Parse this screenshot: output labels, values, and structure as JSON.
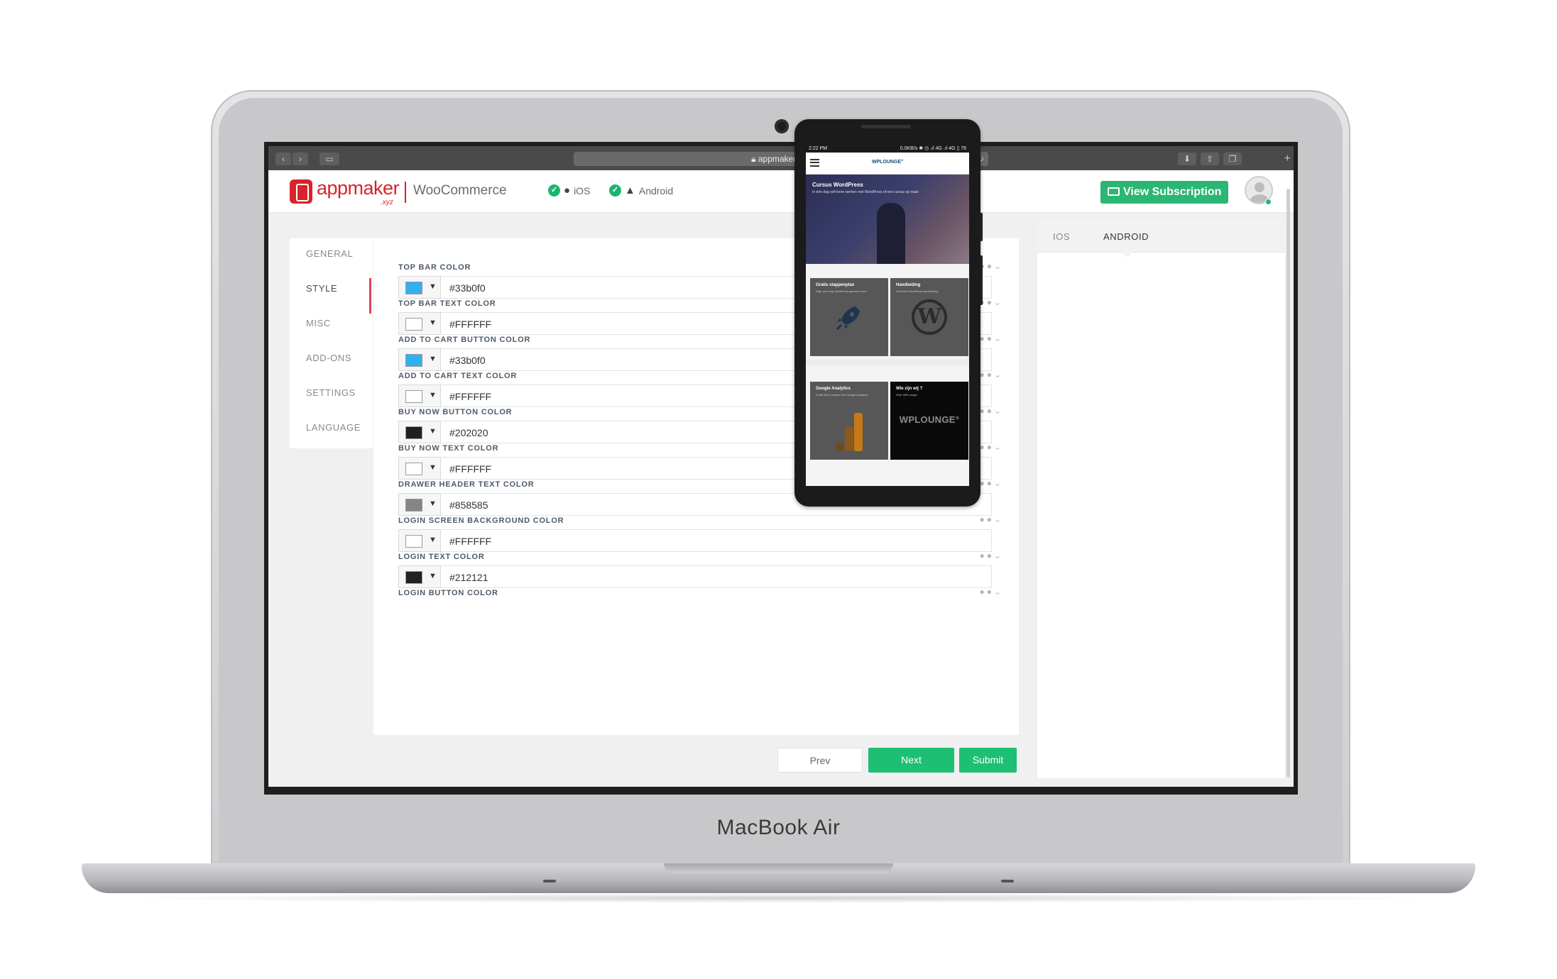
{
  "device": {
    "brand": "MacBook Air"
  },
  "browser": {
    "url": "appmaker.xyz"
  },
  "header": {
    "logo_text": "appmaker",
    "logo_sub": ".xyz",
    "platform": "WooCommerce",
    "ios_label": "iOS",
    "android_label": "Android",
    "subscription_button": "View Subscription"
  },
  "nav": {
    "items": [
      {
        "label": "GENERAL"
      },
      {
        "label": "STYLE"
      },
      {
        "label": "MISC"
      },
      {
        "label": "ADD-ONS"
      },
      {
        "label": "SETTINGS"
      },
      {
        "label": "LANGUAGE"
      }
    ],
    "active": "STYLE"
  },
  "fields": [
    {
      "label": "TOP BAR COLOR",
      "value": "#33b0f0",
      "swatch": "#33b0f0"
    },
    {
      "label": "TOP BAR TEXT COLOR",
      "value": "#FFFFFF",
      "swatch": "#FFFFFF"
    },
    {
      "label": "ADD TO CART BUTTON COLOR",
      "value": "#33b0f0",
      "swatch": "#33b0f0"
    },
    {
      "label": "ADD TO CART TEXT COLOR",
      "value": "#FFFFFF",
      "swatch": "#FFFFFF"
    },
    {
      "label": "BUY NOW BUTTON COLOR",
      "value": "#202020",
      "swatch": "#202020"
    },
    {
      "label": "BUY NOW TEXT COLOR",
      "value": "#FFFFFF",
      "swatch": "#FFFFFF"
    },
    {
      "label": "DRAWER HEADER TEXT COLOR",
      "value": "#858585",
      "swatch": "#858585"
    },
    {
      "label": "LOGIN SCREEN BACKGROUND COLOR",
      "value": "#FFFFFF",
      "swatch": "#FFFFFF"
    },
    {
      "label": "LOGIN TEXT COLOR",
      "value": "#212121",
      "swatch": "#212121"
    },
    {
      "label": "LOGIN BUTTON COLOR",
      "value": "",
      "swatch": ""
    }
  ],
  "buttons": {
    "prev": "Prev",
    "next": "Next",
    "submit": "Submit"
  },
  "preview": {
    "tabs": [
      {
        "label": "IOS"
      },
      {
        "label": "ANDROID"
      }
    ],
    "active_tab": "ANDROID",
    "phone": {
      "status_time": "2:22 PM",
      "status_right": "0.0KB/s ✱ ◷ .ıl 4G .ıl 4G ▯ 76",
      "app_logo": "WPLOUNGE°",
      "hero_title": "Cursus WordPress",
      "hero_sub": "In één dag zelf leren werken met WordPress of een cursus op maat",
      "tiles": [
        {
          "title": "Gratis stappenplan",
          "sub": "Stap voor stap WordPress gewoon leren"
        },
        {
          "title": "Handleiding",
          "sub": "Overzicht WordPress handleiding"
        },
        {
          "title": "Google Analytics",
          "sub": "Gratis leren werken met Google Analytics"
        },
        {
          "title": "Wie zijn wij ?",
          "sub": "Over WPLounge",
          "brand": "WPLOUNGE°"
        }
      ]
    }
  },
  "colors": {
    "accent_red": "#d8232a",
    "success_green": "#1dbf73",
    "nav_active_indicator": "#e0435d"
  }
}
